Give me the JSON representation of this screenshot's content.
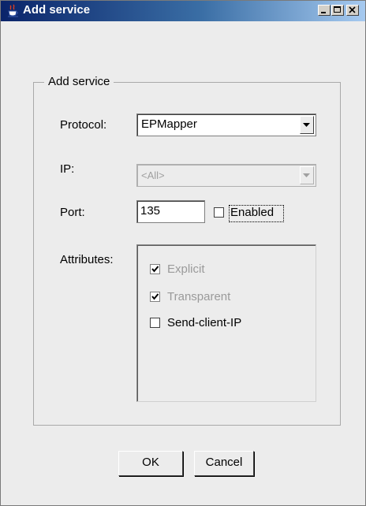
{
  "window": {
    "title": "Add service",
    "icon": "java-coffee-icon",
    "controls": [
      "minimize-icon",
      "maximize-icon",
      "close-icon"
    ]
  },
  "group": {
    "legend": "Add service"
  },
  "form": {
    "protocol_label": "Protocol:",
    "protocol_value": "EPMapper",
    "ip_label": "IP:",
    "ip_value": "<All>",
    "port_label": "Port:",
    "port_value": "135",
    "enabled_label": "Enabled",
    "enabled_checked": false,
    "attributes_label": "Attributes:",
    "attributes": [
      {
        "label": "Explicit",
        "checked": true,
        "enabled": false
      },
      {
        "label": "Transparent",
        "checked": true,
        "enabled": false
      },
      {
        "label": "Send-client-IP",
        "checked": false,
        "enabled": true
      }
    ]
  },
  "buttons": {
    "ok": "OK",
    "cancel": "Cancel"
  },
  "colors": {
    "titlebar_start": "#0a246a",
    "titlebar_end": "#a6caf0",
    "background": "#ececec",
    "disabled_text": "#9a9a9a"
  }
}
